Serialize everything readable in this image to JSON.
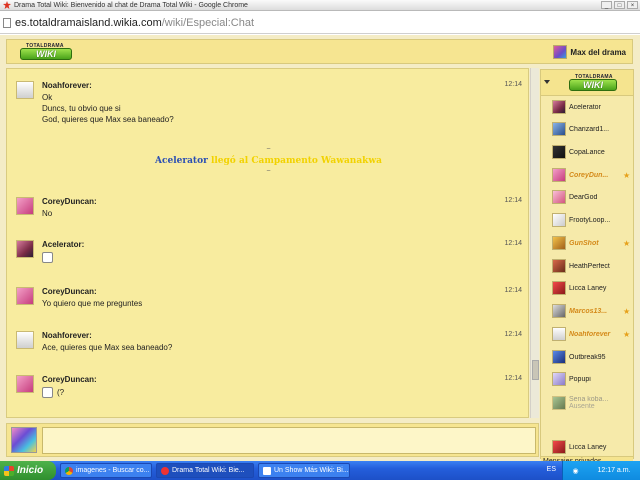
{
  "window": {
    "title": "Drama Total Wiki: Bienvenido al chat de Drama Total Wiki - Google Chrome",
    "buttons": [
      "_",
      "□",
      "×"
    ]
  },
  "address": {
    "host": "es.totaldramaisland.wikia.com",
    "path": "/wiki/Especial:Chat"
  },
  "logo": {
    "top": "TOTALDRAMA",
    "main": "WIKI"
  },
  "header": {
    "user": "Max del drama"
  },
  "messages": [
    {
      "user": "Noahforever:",
      "time": "12:14",
      "lines": [
        "Ok",
        "Duncs, tu obvio que si",
        "God, quieres que Max sea baneado?"
      ]
    },
    {
      "user": "CoreyDuncan:",
      "time": "12:14",
      "lines": [
        "No"
      ]
    },
    {
      "user": "Acelerator:",
      "time": "12:14",
      "lines": []
    },
    {
      "user": "CoreyDuncan:",
      "time": "12:14",
      "lines": [
        "Yo quiero que me preguntes"
      ]
    },
    {
      "user": "Noahforever:",
      "time": "12:14",
      "lines": [
        "Ace, quieres que Max sea baneado?"
      ]
    },
    {
      "user": "CoreyDuncan:",
      "time": "12:14",
      "lines": [
        "(?"
      ]
    }
  ],
  "alert": {
    "tilde": "~",
    "who": "Acelerator",
    "what": "llegó al Campamento Wawanakwa"
  },
  "userlist": {
    "users": [
      {
        "name": "Acelerator",
        "mod": false
      },
      {
        "name": "Charizard1...",
        "mod": false
      },
      {
        "name": "CopaLance",
        "mod": false
      },
      {
        "name": "CoreyDun...",
        "mod": true
      },
      {
        "name": "DearGod",
        "mod": false
      },
      {
        "name": "FrootyLoop...",
        "mod": false
      },
      {
        "name": "GunShot",
        "mod": true
      },
      {
        "name": "HeathPerfect",
        "mod": false
      },
      {
        "name": "Licca Laney",
        "mod": false
      },
      {
        "name": "Marcos13...",
        "mod": true
      },
      {
        "name": "Noahforever",
        "mod": true
      },
      {
        "name": "Outbreak95",
        "mod": false
      },
      {
        "name": "Popupi",
        "mod": false
      },
      {
        "name": "Sena koba...",
        "mod": false,
        "status": "Ausente"
      }
    ],
    "private_header": "Mensajes privados",
    "private_users": [
      "Licca Laney"
    ]
  },
  "taskbar": {
    "start": "Inicio",
    "tasks": [
      "imagenes - Buscar co...",
      "Drama Total Wiki: Bie...",
      "Un Show Más Wiki: Bi..."
    ],
    "lang": "ES",
    "clock": "12:17 a.m."
  }
}
